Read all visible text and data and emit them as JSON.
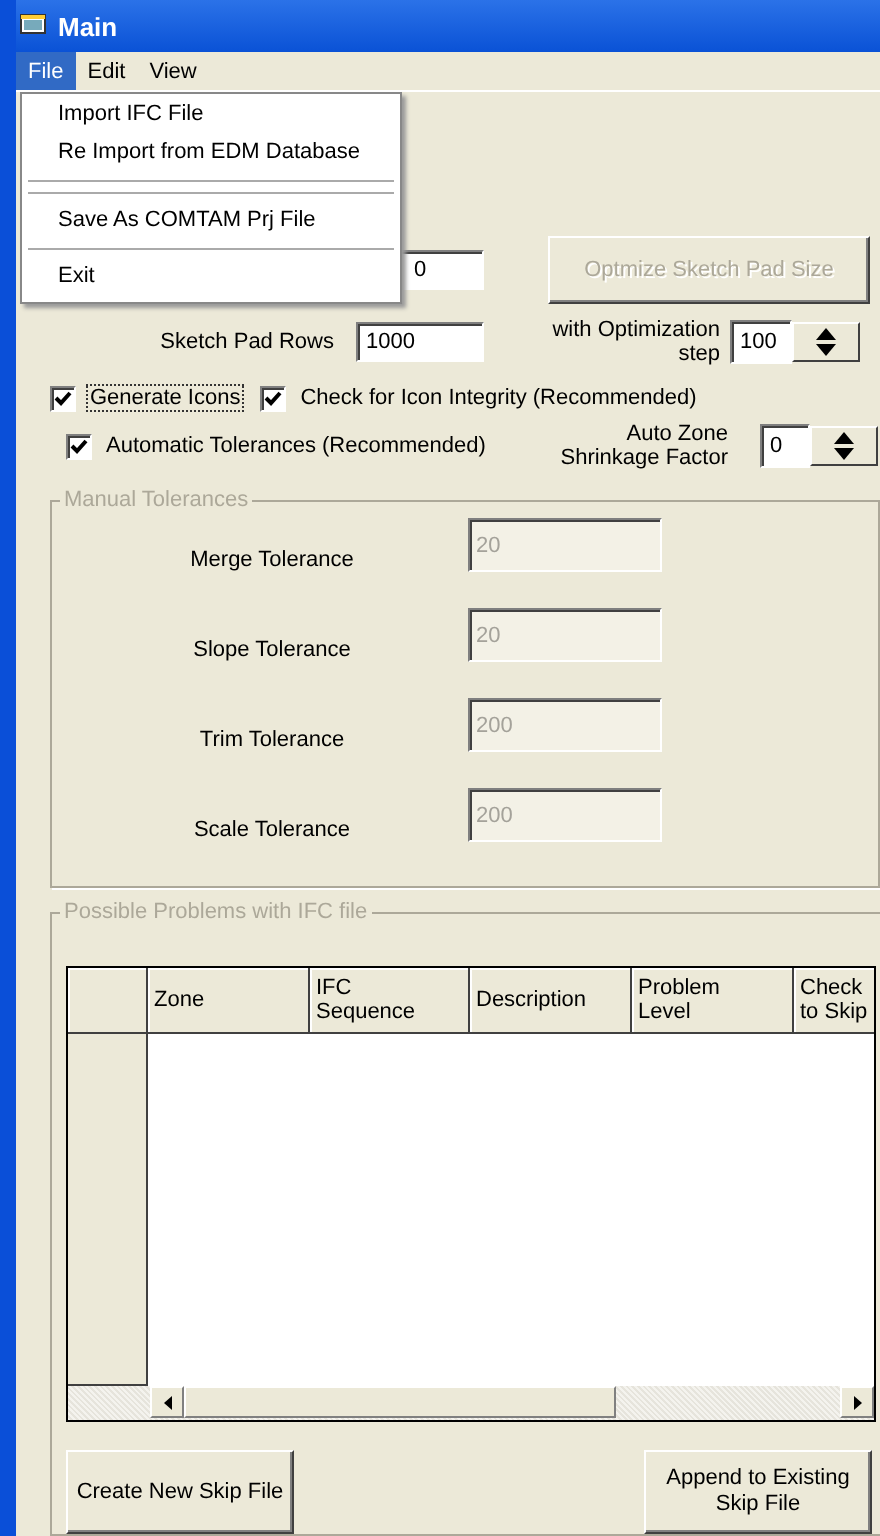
{
  "window": {
    "title": "Main"
  },
  "menu_bar": [
    {
      "label": "File",
      "selected": true
    },
    {
      "label": "Edit",
      "selected": false
    },
    {
      "label": "View",
      "selected": false
    }
  ],
  "file_menu": [
    {
      "kind": "item",
      "label": "Import IFC File"
    },
    {
      "kind": "item",
      "label": "Re Import from EDM Database"
    },
    {
      "kind": "separator"
    },
    {
      "kind": "separator"
    },
    {
      "kind": "item",
      "label": "Save As COMTAM Prj File"
    },
    {
      "kind": "separator"
    },
    {
      "kind": "item",
      "label": "Exit"
    }
  ],
  "partly_hidden_field": {
    "value": "0"
  },
  "optimize_button": {
    "label": "Optmize Sketch Pad Size",
    "disabled": true
  },
  "sketch_pad_rows": {
    "label": "Sketch Pad Rows",
    "value": "1000"
  },
  "optimization_step": {
    "label": "with Optimization step",
    "value": "100"
  },
  "checkboxes": [
    {
      "label": "Generate Icons",
      "checked": true,
      "focused": true
    },
    {
      "label": "Check for Icon Integrity (Recommended)",
      "checked": true,
      "focused": false
    },
    {
      "label": "Automatic Tolerances (Recommended)",
      "checked": true,
      "focused": false
    }
  ],
  "auto_zone_shrinkage": {
    "label": "Auto Zone Shrinkage Factor",
    "value": "0"
  },
  "manual_tolerances": {
    "title": "Manual Tolerances",
    "disabled": true,
    "fields": [
      {
        "label": "Merge Tolerance",
        "value": "20"
      },
      {
        "label": "Slope Tolerance",
        "value": "20"
      },
      {
        "label": "Trim Tolerance",
        "value": "200"
      },
      {
        "label": "Scale Tolerance",
        "value": "200"
      }
    ]
  },
  "problems": {
    "title": "Possible Problems with IFC file",
    "disabled": true,
    "table": {
      "columns": [
        "Zone",
        "IFC Sequence",
        "Description",
        "Problem Level",
        "Check to Skip"
      ]
    }
  },
  "buttons": [
    "Create New Skip File",
    "Append to Existing Skip File"
  ]
}
